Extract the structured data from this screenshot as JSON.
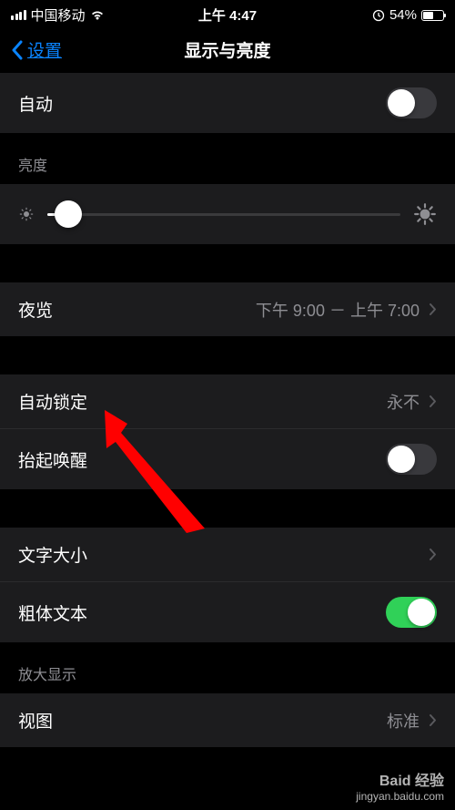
{
  "status": {
    "carrier": "中国移动",
    "time": "上午 4:47",
    "battery_pct": "54%"
  },
  "nav": {
    "back_label": "设置",
    "title": "显示与亮度"
  },
  "rows": {
    "auto": "自动",
    "brightness_header": "亮度",
    "night_shift": "夜览",
    "night_shift_value": "下午 9:00 － 上午 7:00",
    "auto_lock": "自动锁定",
    "auto_lock_value": "永不",
    "raise_to_wake": "抬起唤醒",
    "text_size": "文字大小",
    "bold_text": "粗体文本",
    "zoom_header": "放大显示",
    "view": "视图",
    "view_value": "标准"
  },
  "watermark": {
    "main": "Baid 经验",
    "sub": "jingyan.baidu.com"
  }
}
